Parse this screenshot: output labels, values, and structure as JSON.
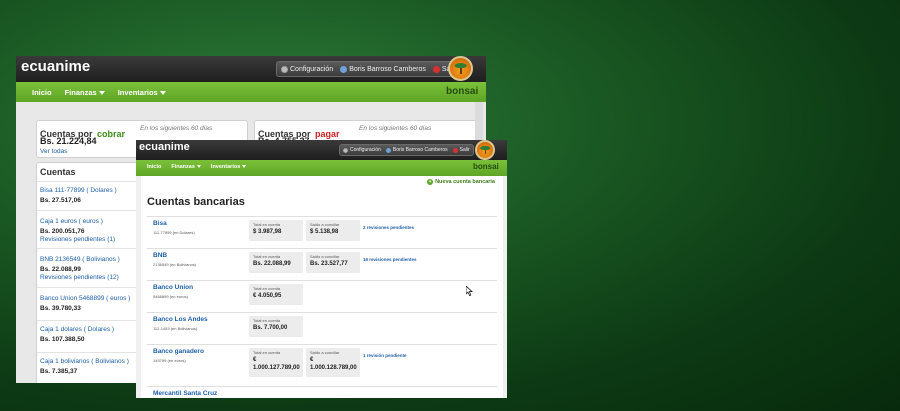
{
  "back_window": {
    "brand": "ecuanime",
    "user_menu": {
      "config_label": "Configuración",
      "user_name": "Boris Barroso Camberos",
      "logout_label": "Salir"
    },
    "nav": {
      "inicio": "Inicio",
      "finanzas": "Finanzas",
      "inventarios": "Inventarios"
    },
    "bonsai_label": "bonsai",
    "cobrar": {
      "title_prefix": "Cuentas por",
      "title_word": "cobrar",
      "period": "En los siguientes 60 días",
      "amount": "Bs. 21.224,84",
      "link": "Ver todas"
    },
    "pagar": {
      "title_prefix": "Cuentas por",
      "title_word": "pagar",
      "period": "En los siguientes 60 días",
      "amount": "Bs. 4.755,37"
    },
    "accounts_title": "Cuentas",
    "accounts": [
      {
        "name": "Bisa 111-77899 ( Dolares )",
        "amount": "Bs. 27.517,06",
        "note": ""
      },
      {
        "name": "Caja 1 euros ( euros )",
        "amount": "Bs. 200.051,76",
        "note": "Revisiones pendientes (1)"
      },
      {
        "name": "BNB 2136549 ( Bolivianos )",
        "amount": "Bs. 22.088,99",
        "note": "Revisiones pendientes (12)"
      },
      {
        "name": "Banco Union 5468899 ( euros )",
        "amount": "Bs. 39.780,33",
        "note": ""
      },
      {
        "name": "Caja 1 dolares ( Dolares )",
        "amount": "Bs. 107.388,50",
        "note": ""
      },
      {
        "name": "Caja 1 bolivianos ( Bolivianos )",
        "amount": "Bs. 7.385,37",
        "note": ""
      }
    ]
  },
  "front_window": {
    "brand": "ecuanime",
    "user_menu": {
      "config_label": "Configuración",
      "user_name": "Boris Barroso Camberos",
      "logout_label": "Salir"
    },
    "nav": {
      "inicio": "Inicio",
      "finanzas": "Finanzas",
      "inventarios": "Inventarios"
    },
    "bonsai_label": "bonsai",
    "new_account": "Nueva cuenta bancaria",
    "title": "Cuentas bancarias",
    "total_label": "Total en cuenta",
    "saldo_label": "Saldo a conciliar",
    "banks": [
      {
        "name": "Bisa",
        "number": "111-77899 (en Dolares)",
        "total": "$ 3.987,98",
        "saldo": "$ 5.138,98",
        "pending": "2 revisiones pendientes"
      },
      {
        "name": "BNB",
        "number": "2136549 (en Bolivianos)",
        "total": "Bs. 22.088,99",
        "saldo": "Bs. 23.527,77",
        "pending": "16 revisiones pendientes"
      },
      {
        "name": "Banco Union",
        "number": "5468899 (en euros)",
        "total": "€ 4.050,95"
      },
      {
        "name": "Banco Los Andes",
        "number": "112-1453 (en Bolivianos)",
        "total": "Bs. 7.700,00"
      },
      {
        "name": "Banco ganadero",
        "number": "145799 (en euros)",
        "total_line1": "€",
        "total_line2": "1.000.127.789,00",
        "saldo_line1": "€",
        "saldo_line2": "1.000.128.789,00",
        "pending": "1 revisión pendiente"
      },
      {
        "name": "Mercantil Santa Cruz"
      }
    ]
  },
  "colors": {
    "nav_green": "#5ea526",
    "link_blue": "#1e5fa8",
    "cobrar_green": "#3e8e1a",
    "pagar_red": "#d02020",
    "topbar_dark": "#1e1e1e"
  }
}
